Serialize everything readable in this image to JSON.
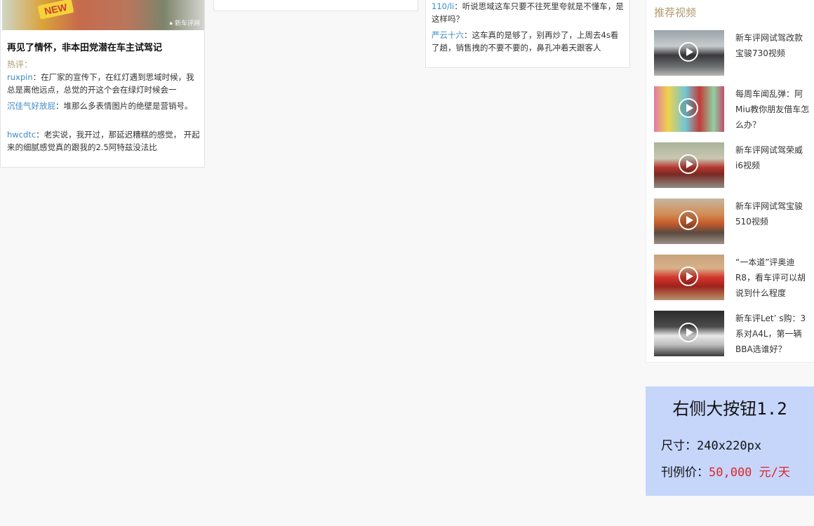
{
  "left_card": {
    "thumb_badge": "NEW",
    "thumb_watermark": "● 新车评网",
    "title": "再见了情怀，非本田党潜在车主试驾记",
    "hot_label": "热评：",
    "comments": [
      {
        "user": "ruxpin",
        "sep": "：",
        "text": "在厂家的宣传下，在红灯遇到思域时候，我总是离他远点，总觉的开这个会在绿灯时候会一"
      },
      {
        "user": "沉佳气好放屁",
        "sep": "：",
        "text": "堆那么多表情图片的绝壁是营销号。"
      },
      {
        "user": "hwcdtc",
        "sep": "：",
        "text": "老实说，我开过，那延迟糟糕的感觉， 开起来的细腻感觉真的跟我的2.5阿特兹没法比"
      }
    ]
  },
  "right_card": {
    "comments": [
      {
        "user": "110/li",
        "sep": "：",
        "text": "听说思域这车只要不往死里夸就是不懂车，是这样吗？"
      },
      {
        "user": "严云十六",
        "sep": "：",
        "text": "这车真的是够了，别再炒了，上周去4s看了趟，销售拽的不要不要的，鼻孔冲着天跟客人"
      }
    ]
  },
  "sidebar": {
    "title": "推荐视频",
    "videos": [
      {
        "title": "新车评网试驾改款宝骏730视频",
        "thumb_icon": "suv-video-thumb"
      },
      {
        "title": "每周车闻乱弹：阿Miu教你朋友借车怎么办？",
        "thumb_icon": "hosts-video-thumb"
      },
      {
        "title": "新车评网试驾荣威i6视频",
        "thumb_icon": "red-sedan-video-thumb"
      },
      {
        "title": "新车评网试驾宝骏510视频",
        "thumb_icon": "orange-suv-video-thumb"
      },
      {
        "title": "“一本道”评奥迪R8，看车评可以胡说到什么程度",
        "thumb_icon": "red-sportscar-video-thumb"
      },
      {
        "title": "新车评Let’ s购：3系对A4L，第一辆BBA选谁好？",
        "thumb_icon": "white-sedans-video-thumb"
      }
    ]
  },
  "ad": {
    "title": "右侧大按钮1.2",
    "size_label": "尺寸：",
    "size_value": "240x220px",
    "price_label": "刊例价：",
    "price_value": "50,000 元/天",
    "price_color": "#e0242a",
    "background": "#c6d6fb"
  }
}
